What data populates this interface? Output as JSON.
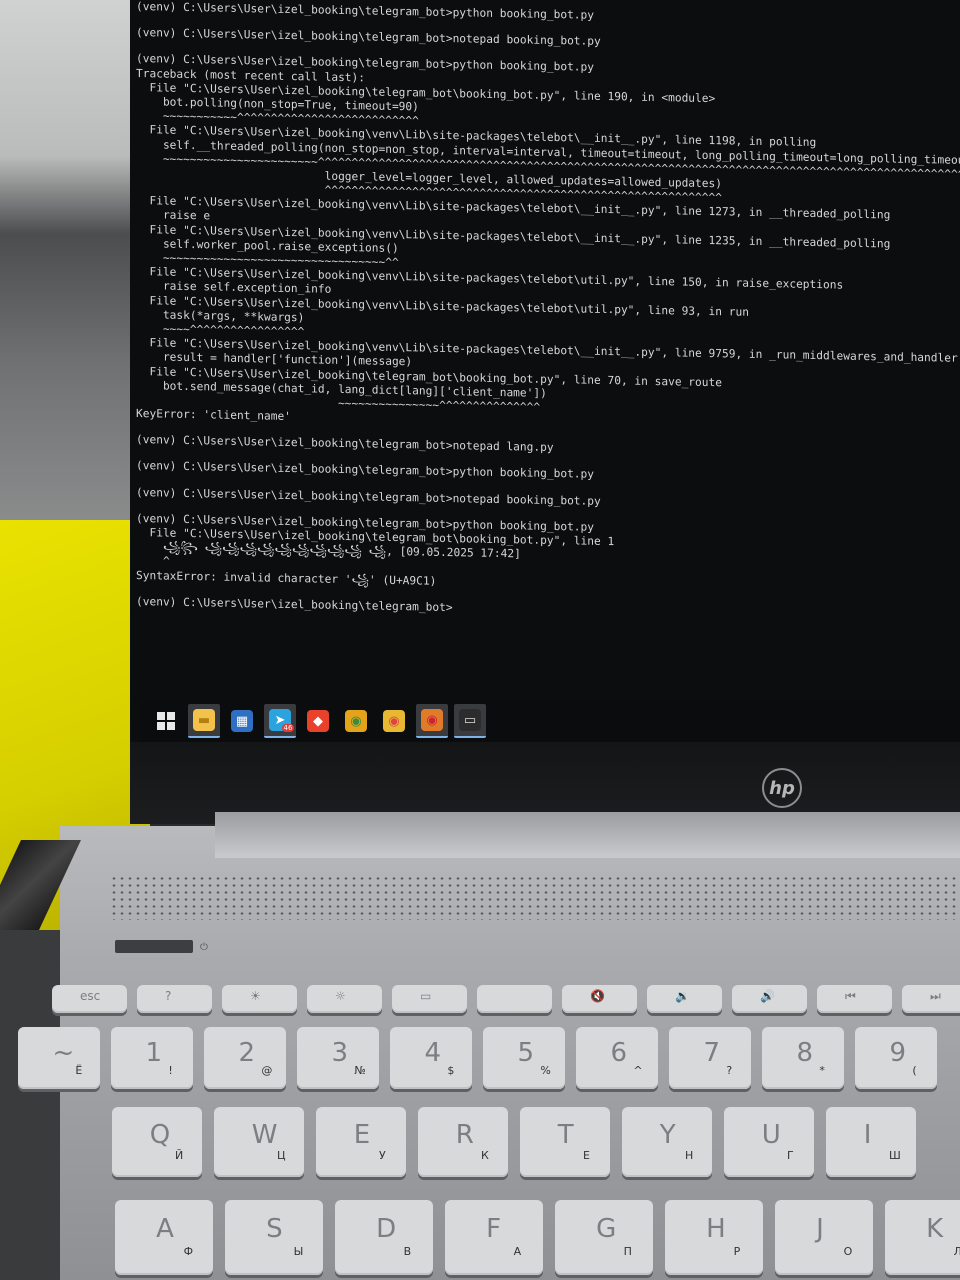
{
  "terminal": {
    "lines": [
      "(venv) C:\\Users\\User\\izel_booking\\telegram_bot>python booking_bot.py",
      "",
      "(venv) C:\\Users\\User\\izel_booking\\telegram_bot>notepad booking_bot.py",
      "",
      "(venv) C:\\Users\\User\\izel_booking\\telegram_bot>python booking_bot.py",
      "Traceback (most recent call last):",
      "  File \"C:\\Users\\User\\izel_booking\\telegram_bot\\booking_bot.py\", line 190, in <module>",
      "    bot.polling(non_stop=True, timeout=90)",
      "    ~~~~~~~~~~~^^^^^^^^^^^^^^^^^^^^^^^^^^^",
      "  File \"C:\\Users\\User\\izel_booking\\venv\\Lib\\site-packages\\telebot\\__init__.py\", line 1198, in polling",
      "    self.__threaded_polling(non_stop=non_stop, interval=interval, timeout=timeout, long_polling_timeout=long_polling_timeout,",
      "    ~~~~~~~~~~~~~~~~~~~~~~~^^^^^^^^^^^^^^^^^^^^^^^^^^^^^^^^^^^^^^^^^^^^^^^^^^^^^^^^^^^^^^^^^^^^^^^^^^^^^^^^^^^^^^^^^^^^^^^^^^",
      "                            logger_level=logger_level, allowed_updates=allowed_updates)",
      "                            ^^^^^^^^^^^^^^^^^^^^^^^^^^^^^^^^^^^^^^^^^^^^^^^^^^^^^^^^^^^",
      "  File \"C:\\Users\\User\\izel_booking\\venv\\Lib\\site-packages\\telebot\\__init__.py\", line 1273, in __threaded_polling",
      "    raise e",
      "  File \"C:\\Users\\User\\izel_booking\\venv\\Lib\\site-packages\\telebot\\__init__.py\", line 1235, in __threaded_polling",
      "    self.worker_pool.raise_exceptions()",
      "    ~~~~~~~~~~~~~~~~~~~~~~~~~~~~~~~~~^^",
      "  File \"C:\\Users\\User\\izel_booking\\venv\\Lib\\site-packages\\telebot\\util.py\", line 150, in raise_exceptions",
      "    raise self.exception_info",
      "  File \"C:\\Users\\User\\izel_booking\\venv\\Lib\\site-packages\\telebot\\util.py\", line 93, in run",
      "    task(*args, **kwargs)",
      "    ~~~~^^^^^^^^^^^^^^^^^",
      "  File \"C:\\Users\\User\\izel_booking\\venv\\Lib\\site-packages\\telebot\\__init__.py\", line 9759, in _run_middlewares_and_handler",
      "    result = handler['function'](message)",
      "  File \"C:\\Users\\User\\izel_booking\\telegram_bot\\booking_bot.py\", line 70, in save_route",
      "    bot.send_message(chat_id, lang_dict[lang]['client_name'])",
      "                              ~~~~~~~~~~~~~~~^^^^^^^^^^^^^^^",
      "KeyError: 'client_name'",
      "",
      "(venv) C:\\Users\\User\\izel_booking\\telegram_bot>notepad lang.py",
      "",
      "(venv) C:\\Users\\User\\izel_booking\\telegram_bot>python booking_bot.py",
      "",
      "(venv) C:\\Users\\User\\izel_booking\\telegram_bot>notepad booking_bot.py",
      "",
      "(venv) C:\\Users\\User\\izel_booking\\telegram_bot>python booking_bot.py",
      "  File \"C:\\Users\\User\\izel_booking\\telegram_bot\\booking_bot.py\", line 1",
      "    ꧁꧂ ꧁꧁꧁꧁꧁꧁꧁꧁꧁ ꧁, [09.05.2025 17:42]",
      "    ^",
      "SyntaxError: invalid character '꧁' (U+A9C1)",
      "",
      "(venv) C:\\Users\\User\\izel_booking\\telegram_bot>"
    ]
  },
  "taskbar": {
    "items": [
      {
        "icon": "windows-start-icon",
        "active": false
      },
      {
        "icon": "file-explorer-icon",
        "active": true
      },
      {
        "icon": "microsoft-store-icon",
        "active": false
      },
      {
        "icon": "telegram-icon",
        "active": true,
        "badge": "46"
      },
      {
        "icon": "anydesk-icon",
        "active": false
      },
      {
        "icon": "chrome-icon",
        "active": false
      },
      {
        "icon": "chrome-canary-icon",
        "active": false
      },
      {
        "icon": "chrome-profile-icon",
        "active": true
      },
      {
        "icon": "command-prompt-icon",
        "active": true
      }
    ]
  },
  "laptop": {
    "brand_logo": "hp"
  },
  "keyboard": {
    "fn_row": [
      "esc",
      "?",
      "☀",
      "☼",
      "▭",
      "",
      "🔇",
      "🔉",
      "🔊",
      "⏮",
      "⏭"
    ],
    "number_row": [
      {
        "main": "~",
        "sub": "Ё"
      },
      {
        "main": "1",
        "sub": "!"
      },
      {
        "main": "2",
        "sub": "@"
      },
      {
        "main": "3",
        "sub": "№"
      },
      {
        "main": "4",
        "sub": "$"
      },
      {
        "main": "5",
        "sub": "%"
      },
      {
        "main": "6",
        "sub": "^"
      },
      {
        "main": "7",
        "sub": "?"
      },
      {
        "main": "8",
        "sub": "*"
      },
      {
        "main": "9",
        "sub": "("
      }
    ],
    "qwerty_row": [
      {
        "main": "Q",
        "sub": "Й"
      },
      {
        "main": "W",
        "sub": "Ц"
      },
      {
        "main": "E",
        "sub": "У"
      },
      {
        "main": "R",
        "sub": "К"
      },
      {
        "main": "T",
        "sub": "Е"
      },
      {
        "main": "Y",
        "sub": "Н"
      },
      {
        "main": "U",
        "sub": "Г"
      },
      {
        "main": "I",
        "sub": "Ш"
      }
    ],
    "home_row": [
      {
        "main": "A",
        "sub": "Ф"
      },
      {
        "main": "S",
        "sub": "Ы"
      },
      {
        "main": "D",
        "sub": "В"
      },
      {
        "main": "F",
        "sub": "А"
      },
      {
        "main": "G",
        "sub": "П"
      },
      {
        "main": "H",
        "sub": "Р"
      },
      {
        "main": "J",
        "sub": "О"
      },
      {
        "main": "K",
        "sub": "Л"
      }
    ]
  }
}
